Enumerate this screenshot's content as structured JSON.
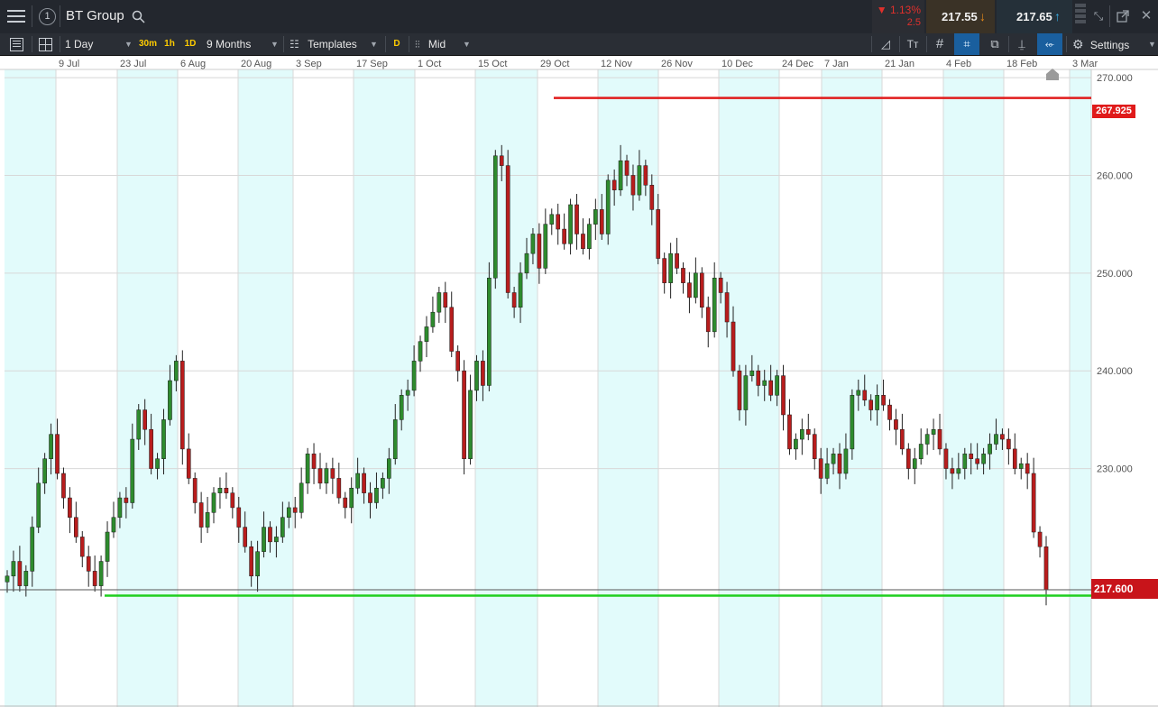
{
  "topbar": {
    "instrument": "BT Group",
    "circle_number": "1",
    "change_percent": "▼ 1.13%",
    "change_abs": "2.5",
    "sell_price": "217.55",
    "buy_price": "217.65",
    "colors": {
      "down": "#e0302c",
      "sell_bg": "#3a3226",
      "buy_bg": "#253039",
      "sell_arrow": "#e88a1a",
      "buy_arrow": "#3ab0e6"
    }
  },
  "toolbar": {
    "interval": "1 Day",
    "quick_intervals": [
      "30m",
      "1h",
      "1D"
    ],
    "range": "9 Months",
    "templates": "Templates",
    "d_badge": "D",
    "price_type": "Mid",
    "settings": "Settings"
  },
  "chart_data": {
    "type": "candlestick",
    "instrument": "BT Group",
    "x_tick_labels": [
      "9 Jul",
      "23 Jul",
      "6 Aug",
      "20 Aug",
      "3 Sep",
      "17 Sep",
      "1 Oct",
      "15 Oct",
      "29 Oct",
      "12 Nov",
      "26 Nov",
      "10 Dec",
      "24 Dec",
      "7 Jan",
      "21 Jan",
      "4 Feb",
      "18 Feb",
      "3 Mar"
    ],
    "y_tick_labels": [
      "270.000",
      "260.000",
      "250.000",
      "240.000",
      "230.000"
    ],
    "y_ticks": [
      270,
      260,
      250,
      240,
      230
    ],
    "ylim": [
      205.6,
      271.3
    ],
    "horizontal_lines": [
      {
        "label": "267.925",
        "value": 267.925,
        "color": "#e01b1b"
      },
      {
        "label": "217.600",
        "value": 217.6,
        "color": "#e01b1b"
      }
    ],
    "support_line": {
      "value": 217.0,
      "color": "#1fcf1f"
    },
    "colors": {
      "up": "#2e8b2e",
      "down": "#b81d1d",
      "wick": "#222222",
      "band": "#e2fbfb",
      "grid": "#d8d8d8"
    },
    "closes": [
      219.0,
      220.5,
      218.0,
      219.5,
      224.0,
      228.5,
      231.0,
      233.5,
      229.5,
      227.0,
      225.0,
      223.0,
      221.0,
      219.5,
      218.0,
      220.5,
      223.5,
      225.0,
      227.0,
      226.5,
      233.0,
      236.0,
      234.0,
      230.0,
      231.0,
      235.0,
      239.0,
      241.0,
      232.0,
      229.0,
      226.5,
      224.0,
      225.5,
      227.5,
      228.0,
      227.5,
      226.0,
      224.0,
      222.0,
      219.0,
      221.5,
      224.0,
      222.5,
      223.0,
      225.0,
      226.0,
      225.5,
      228.5,
      231.5,
      230.0,
      228.5,
      230.0,
      229.0,
      227.0,
      226.0,
      228.0,
      229.5,
      227.5,
      226.5,
      228.0,
      229.0,
      231.0,
      235.0,
      237.5,
      238.0,
      241.0,
      243.0,
      244.5,
      246.0,
      248.0,
      246.5,
      242.0,
      240.0,
      231.0,
      238.0,
      241.0,
      238.5,
      249.5,
      262.0,
      261.0,
      248.0,
      246.5,
      250.0,
      252.0,
      254.0,
      250.5,
      255.0,
      256.0,
      254.5,
      253.0,
      257.0,
      254.0,
      252.5,
      255.0,
      256.5,
      254.0,
      259.5,
      258.5,
      261.5,
      260.0,
      258.0,
      261.0,
      259.0,
      256.5,
      251.5,
      249.0,
      252.0,
      250.5,
      249.0,
      247.5,
      250.0,
      246.5,
      244.0,
      249.5,
      248.0,
      245.0,
      240.0,
      236.0,
      239.5,
      240.0,
      238.5,
      239.0,
      237.5,
      239.5,
      235.5,
      232.0,
      233.0,
      234.0,
      233.5,
      231.0,
      229.0,
      230.5,
      231.5,
      229.5,
      232.0,
      237.5,
      238.0,
      237.0,
      236.0,
      237.5,
      236.5,
      235.0,
      234.0,
      232.0,
      230.0,
      231.0,
      232.5,
      233.5,
      234.0,
      232.0,
      230.0,
      229.5,
      230.0,
      231.5,
      231.0,
      230.5,
      231.5,
      232.5,
      233.5,
      233.0,
      232.0,
      230.0,
      230.5,
      229.5,
      223.5,
      222.0,
      217.6
    ]
  }
}
